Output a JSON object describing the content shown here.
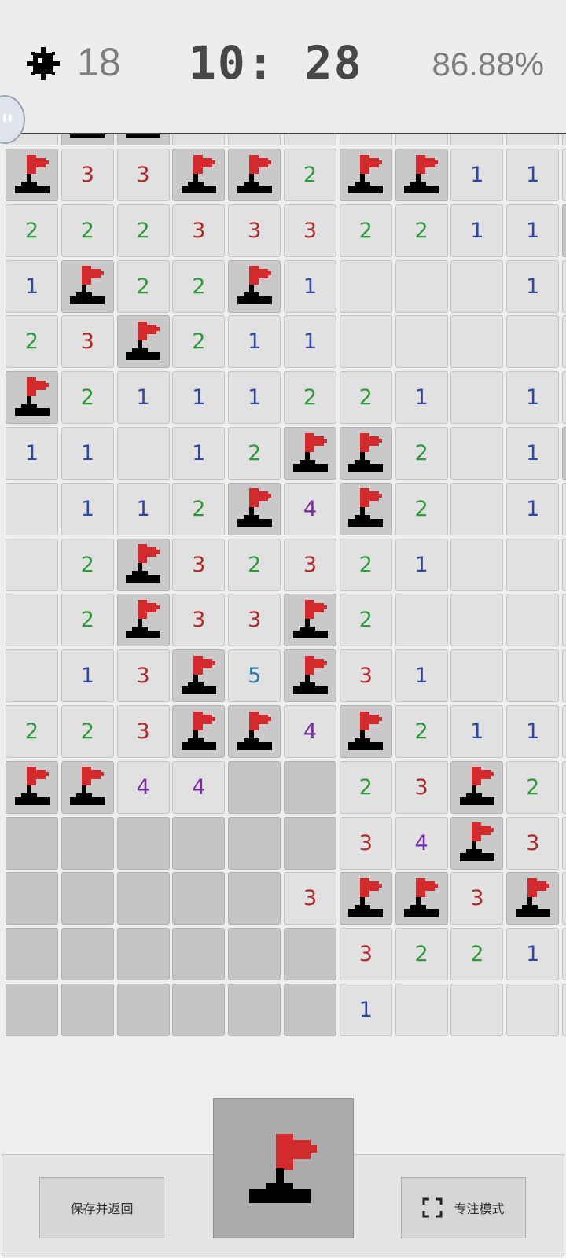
{
  "header": {
    "mine_count": "18",
    "timer": "10: 28",
    "progress": "86.88%",
    "mine_icon": "mine-icon",
    "assist_icon": "floating-assistant-icon"
  },
  "board": {
    "columns_visible": 10,
    "rows": [
      [
        "F",
        "3",
        "3",
        "F",
        "F",
        "2",
        "F",
        "F",
        "1",
        "1"
      ],
      [
        "2",
        "2",
        "2",
        "3",
        "3",
        "3",
        "2",
        "2",
        "1",
        "1"
      ],
      [
        "1",
        "F",
        "2",
        "2",
        "F",
        "1",
        "",
        "",
        "",
        "1"
      ],
      [
        "2",
        "3",
        "F",
        "2",
        "1",
        "1",
        "",
        "",
        "",
        ""
      ],
      [
        "F",
        "2",
        "1",
        "1",
        "1",
        "2",
        "2",
        "1",
        "",
        "1"
      ],
      [
        "1",
        "1",
        "",
        "1",
        "2",
        "F",
        "F",
        "2",
        "",
        "1"
      ],
      [
        "",
        "1",
        "1",
        "2",
        "F",
        "4",
        "F",
        "2",
        "",
        "1"
      ],
      [
        "",
        "2",
        "F",
        "3",
        "2",
        "3",
        "2",
        "1",
        "",
        ""
      ],
      [
        "",
        "2",
        "F",
        "3",
        "3",
        "F",
        "2",
        "",
        "",
        ""
      ],
      [
        "",
        "1",
        "3",
        "F",
        "5",
        "F",
        "3",
        "1",
        "",
        ""
      ],
      [
        "2",
        "2",
        "3",
        "F",
        "F",
        "4",
        "F",
        "2",
        "1",
        "1"
      ],
      [
        "F",
        "F",
        "4",
        "4",
        "#",
        "#",
        "2",
        "3",
        "F",
        "2"
      ],
      [
        "#",
        "#",
        "#",
        "#",
        "#",
        "#",
        "3",
        "4",
        "F",
        "3"
      ],
      [
        "#",
        "#",
        "#",
        "#",
        "#",
        "3",
        "F",
        "F",
        "3",
        "F"
      ],
      [
        "#",
        "#",
        "#",
        "#",
        "#",
        "#",
        "3",
        "2",
        "2",
        "1"
      ],
      [
        "#",
        "#",
        "#",
        "#",
        "#",
        "#",
        "1",
        "",
        "",
        ""
      ]
    ],
    "legend": {
      "F": "flag",
      "#": "unrevealed",
      "": "empty"
    },
    "number_colors": {
      "1": "#2f48a6",
      "2": "#2e9a39",
      "3": "#b12a2a",
      "4": "#7a2da4",
      "5": "#2d7fa8"
    },
    "flag_color": "#d32a2e"
  },
  "controls": {
    "save_return_label": "保存并返回",
    "focus_mode_label": "专注模式",
    "flag_mode_icon": "flag-icon",
    "focus_icon": "fullscreen-icon"
  }
}
